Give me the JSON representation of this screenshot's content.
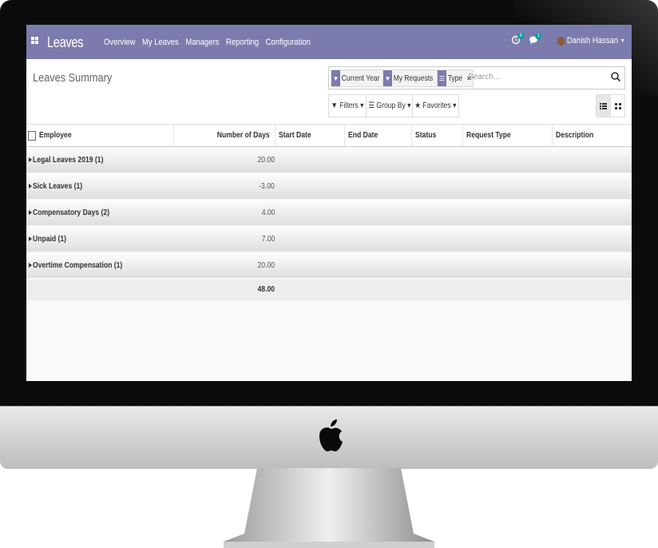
{
  "app": {
    "title": "Leaves",
    "menu": [
      "Overview",
      "My Leaves",
      "Managers",
      "Reporting",
      "Configuration"
    ],
    "activity_count": "3",
    "message_count": "1",
    "user_name": "Danish Hassan",
    "accent_color": "#7c7bad",
    "badge_color": "#00a09d"
  },
  "control_panel": {
    "breadcrumb": "Leaves Summary",
    "facets": [
      {
        "icon": "filter-icon",
        "label": "Current Year"
      },
      {
        "icon": "filter-icon",
        "label": "My Requests"
      },
      {
        "icon": "group-by-icon",
        "label": "Type"
      }
    ],
    "search_placeholder": "Search...",
    "filters_label": "Filters",
    "group_by_label": "Group By",
    "favorites_label": "Favorites"
  },
  "table": {
    "columns": [
      "Employee",
      "Number of Days",
      "Start Date",
      "End Date",
      "Status",
      "Request Type",
      "Description"
    ],
    "groups": [
      {
        "name": "Legal Leaves 2019 (1)",
        "days": "20.00"
      },
      {
        "name": "Sick Leaves (1)",
        "days": "-3.00"
      },
      {
        "name": "Compensatory Days (2)",
        "days": "4.00"
      },
      {
        "name": "Unpaid (1)",
        "days": "7.00"
      },
      {
        "name": "Overtime Compensation (1)",
        "days": "20.00"
      }
    ],
    "total_days": "48.00"
  }
}
